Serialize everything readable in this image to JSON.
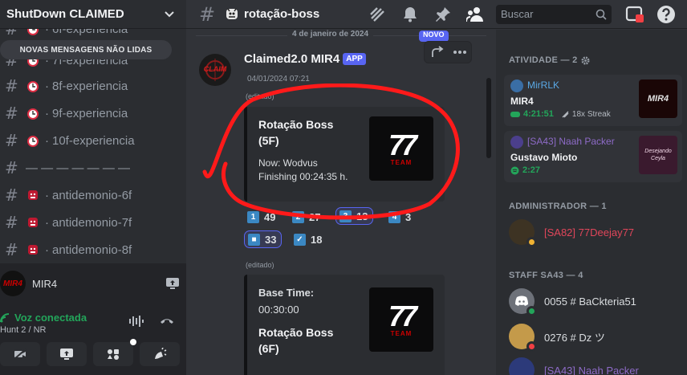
{
  "server": {
    "name": "ShutDown CLAIMED"
  },
  "new_messages_banner": "NOVAS MENSAGENS NÃO LIDAS",
  "channels": [
    {
      "label": "6f-experiencia",
      "emoji": "alarm-clock-icon"
    },
    {
      "label": "7f-experiencia",
      "emoji": "alarm-clock-icon"
    },
    {
      "label": "8f-experiencia",
      "emoji": "alarm-clock-icon"
    },
    {
      "label": "9f-experiencia",
      "emoji": "alarm-clock-icon"
    },
    {
      "label": "10f-experiencia",
      "emoji": "alarm-clock-icon"
    },
    {
      "label": "— — — — — — —",
      "emoji": ""
    },
    {
      "label": "antidemonio-6f",
      "emoji": "ogre-icon"
    },
    {
      "label": "antidemonio-7f",
      "emoji": "ogre-icon"
    },
    {
      "label": "antidemonio-8f",
      "emoji": "ogre-icon"
    }
  ],
  "channel_separator": "·",
  "user_panel": {
    "name": "MIR4",
    "avatar_text": "MIR4"
  },
  "voice": {
    "status": "Voz conectada",
    "channel": "Hunt 2 / NR"
  },
  "header": {
    "channel": "rotação-boss",
    "search_placeholder": "Buscar"
  },
  "messages": {
    "date": "4 de janeiro de 2024",
    "new_badge": "NOVO",
    "author": "Claimed2.0 MIR4",
    "author_badge": "APP",
    "avatar_text": "CLAIM",
    "timestamp": "04/01/2024 07:21",
    "edited": "(editado)",
    "embed1": {
      "title_1": "Rotação Boss",
      "title_2": "(5F)",
      "line_1": "Now: Wodvus",
      "line_2": "Finishing 00:24:35 h."
    },
    "thumb": {
      "big": "77",
      "small": "TEAM"
    },
    "reactions": [
      {
        "key": "1",
        "count": "49",
        "me": false
      },
      {
        "key": "2",
        "count": "27",
        "me": false
      },
      {
        "key": "3",
        "count": "13",
        "me": true
      },
      {
        "key": "4",
        "count": "3",
        "me": false
      },
      {
        "key": "■",
        "count": "33",
        "me": true
      },
      {
        "key": "✓",
        "count": "18",
        "me": false
      }
    ],
    "edited2": "(editado)",
    "embed2": {
      "label": "Base Time:",
      "time": "00:30:00",
      "title_1": "Rotação Boss",
      "title_2": "(6F)"
    }
  },
  "members": {
    "activity_title": "ATIVIDADE — 2",
    "activities": [
      {
        "user": "MirRLK",
        "user_color": "#5aa9e6",
        "game": "MIR4",
        "time": "4:21:51",
        "streak": "18x Streak",
        "img_text": "MIR4"
      },
      {
        "user": "[SA43] Naah Packer",
        "user_color": "#8e6bc8",
        "game": "Gustavo Mioto",
        "time": "2:27",
        "streak": "",
        "img_text": "Desejando Ceyla"
      }
    ],
    "admin_title": "ADMINISTRADOR — 1",
    "admins": [
      {
        "name": "[SA82] 77Deejay77",
        "color": "#e0465a",
        "status": "#f0b232"
      }
    ],
    "staff_title": "STAFF SA43 — 4",
    "staff": [
      {
        "name": "0055 # BaCkteria51",
        "color": "#dbdee1",
        "status": "#23a55a"
      },
      {
        "name": "0276 # Dz ツ",
        "color": "#dbdee1",
        "status": "#f23f43"
      },
      {
        "name": "[SA43] Naah Packer",
        "color": "#8e6bc8",
        "status": "#23a55a"
      }
    ]
  }
}
